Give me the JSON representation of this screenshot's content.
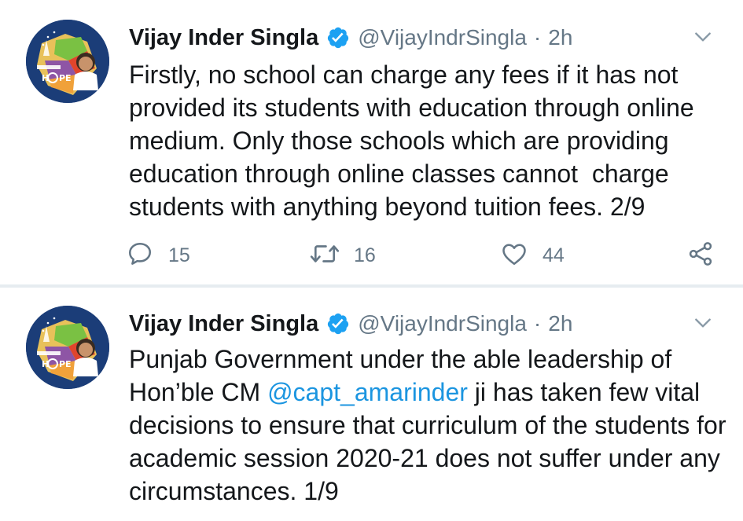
{
  "tweets": [
    {
      "author_name": "Vijay Inder Singla",
      "handle": "@VijayIndrSingla",
      "separator": "·",
      "time": "2h",
      "text": "Firstly, no school can charge any fees if it has not provided its students with education through online medium. Only those schools which are providing education through online classes cannot  charge students with anything beyond tuition fees. 2/9",
      "replies": "15",
      "retweets": "16",
      "likes": "44",
      "avatar_text": "AMBASSADOR HOPE"
    },
    {
      "author_name": "Vijay Inder Singla",
      "handle": "@VijayIndrSingla",
      "separator": "·",
      "time": "2h",
      "text_before_mention": "Punjab Government under the able leadership of Hon’ble CM ",
      "mention": "@capt_amarinder",
      "text_after_mention": " ji has taken few vital decisions to ensure that curriculum of the students for academic session 2020-21 does not suffer under any circumstances. 1/9",
      "avatar_text": "AMBASSADOR HOPE"
    }
  ],
  "colors": {
    "link": "#1b95e0",
    "verified": "#1da1f2",
    "secondary_text": "#657786",
    "divider": "#e6ecf0"
  },
  "icons": {
    "verified": "verified-badge-icon",
    "menu": "chevron-down-icon",
    "reply": "reply-icon",
    "retweet": "retweet-icon",
    "like": "heart-icon",
    "share": "share-icon"
  }
}
